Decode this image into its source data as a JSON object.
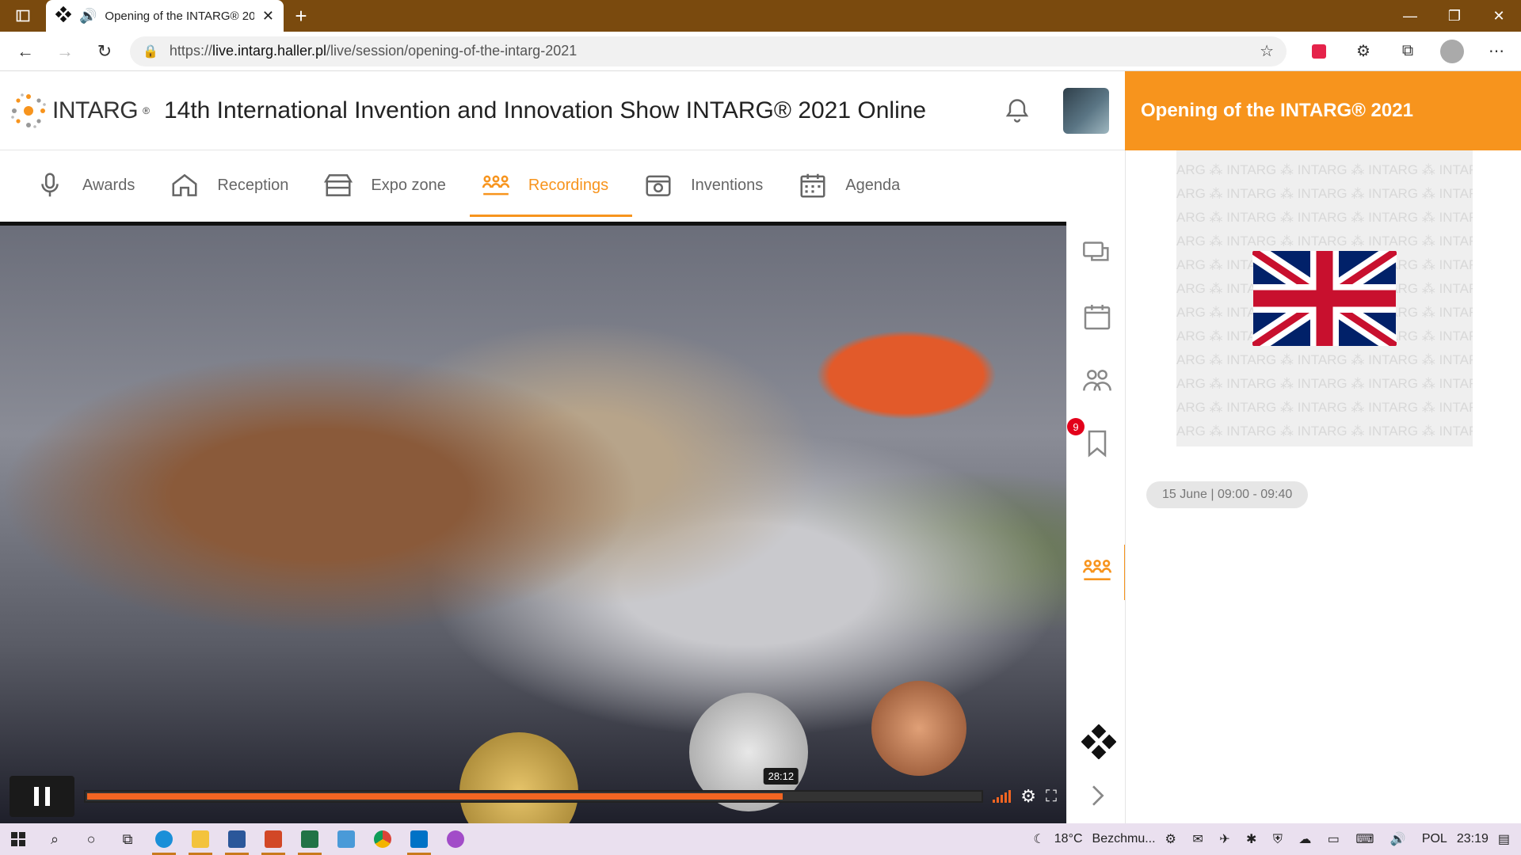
{
  "browser": {
    "tab_title": "Opening of the INTARG® 2021",
    "url_prefix": "https://",
    "url_host": "live.intarg.haller.pl",
    "url_path": "/live/session/opening-of-the-intarg-2021",
    "icons": [
      "tab-actions-icon",
      "speaker-icon",
      "close-icon",
      "plus-icon",
      "minimize-icon",
      "restore-icon",
      "close-window-icon",
      "back-icon",
      "forward-icon",
      "refresh-icon",
      "lock-icon",
      "favorites-add-icon",
      "extension-icon",
      "puzzle-icon",
      "collections-icon",
      "profile-icon",
      "more-icon"
    ]
  },
  "app": {
    "logo_text": "INTARG",
    "logo_mark": "®",
    "title": "14th International Invention and Innovation Show INTARG® 2021 Online",
    "nav": [
      {
        "label": "Awards",
        "icon": "microphone-icon"
      },
      {
        "label": "Reception",
        "icon": "home-icon"
      },
      {
        "label": "Expo zone",
        "icon": "booth-icon"
      },
      {
        "label": "Recordings",
        "icon": "audience-icon",
        "active": true
      },
      {
        "label": "Inventions",
        "icon": "device-icon"
      },
      {
        "label": "Agenda",
        "icon": "calendar-icon"
      }
    ],
    "accent_color": "#f7941d",
    "bell_icon": "bell-icon"
  },
  "video": {
    "time_tooltip": "28:12",
    "progress": 0.776,
    "state": "playing"
  },
  "rail": {
    "badge_count": "9",
    "icons": [
      "chat-icon",
      "calendar-icon",
      "people-icon",
      "bookmark-icon",
      "audience-icon"
    ]
  },
  "session": {
    "title": "Opening of the INTARG® 2021",
    "date": "15 June | 09:00 - 09:40"
  },
  "taskbar": {
    "weather": "18°C",
    "weather_text": "Bezchmu...",
    "language": "POL",
    "time": "23:19"
  }
}
